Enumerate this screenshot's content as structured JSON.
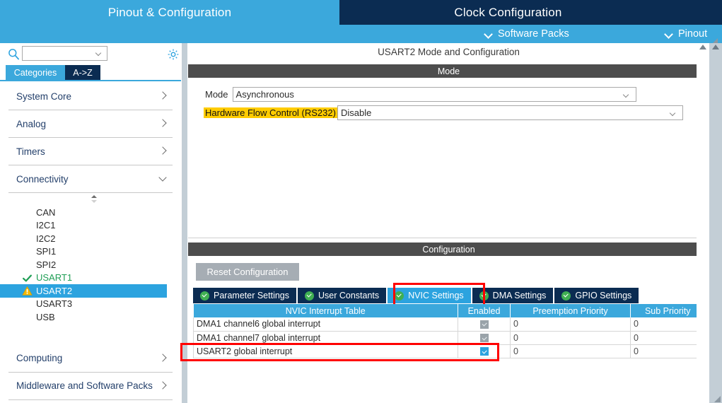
{
  "header": {
    "tabs": [
      {
        "label": "Pinout & Configuration",
        "active": true
      },
      {
        "label": "Clock Configuration",
        "active": false
      },
      {
        "label": "",
        "active": false
      }
    ],
    "menus": [
      {
        "label": "Software Packs",
        "icon": "chevron-down-icon"
      },
      {
        "label": "Pinout",
        "icon": "chevron-down-icon"
      }
    ]
  },
  "sidebar": {
    "search": {
      "value": "",
      "placeholder": "",
      "icon": "search-icon"
    },
    "settings_icon": "gear-icon",
    "view_tabs": [
      {
        "label": "Categories",
        "active": true
      },
      {
        "label": "A->Z",
        "active": false
      }
    ],
    "groups": [
      {
        "label": "System Core",
        "expanded": false
      },
      {
        "label": "Analog",
        "expanded": false
      },
      {
        "label": "Timers",
        "expanded": false
      },
      {
        "label": "Connectivity",
        "expanded": true
      }
    ],
    "peripherals": [
      {
        "label": "CAN",
        "status": "none"
      },
      {
        "label": "I2C1",
        "status": "none"
      },
      {
        "label": "I2C2",
        "status": "none"
      },
      {
        "label": "SPI1",
        "status": "none"
      },
      {
        "label": "SPI2",
        "status": "none"
      },
      {
        "label": "USART1",
        "status": "ok"
      },
      {
        "label": "USART2",
        "status": "warning",
        "selected": true
      },
      {
        "label": "USART3",
        "status": "none"
      },
      {
        "label": "USB",
        "status": "none"
      }
    ],
    "trailing_groups": [
      {
        "label": "Computing",
        "expanded": false
      },
      {
        "label": "Middleware and Software Packs",
        "expanded": false
      }
    ]
  },
  "main": {
    "panel_title": "USART2 Mode and Configuration",
    "mode_section": {
      "header": "Mode",
      "fields": [
        {
          "label": "Mode",
          "value": "Asynchronous",
          "highlighted": false
        },
        {
          "label": "Hardware Flow Control (RS232)",
          "value": "Disable",
          "highlighted": true
        }
      ]
    },
    "config_section": {
      "header": "Configuration",
      "reset_button": "Reset Configuration",
      "tabs": [
        {
          "label": "Parameter Settings",
          "active": false
        },
        {
          "label": "User Constants",
          "active": false
        },
        {
          "label": "NVIC Settings",
          "active": true
        },
        {
          "label": "DMA Settings",
          "active": false
        },
        {
          "label": "GPIO Settings",
          "active": false
        }
      ],
      "table": {
        "columns": [
          "NVIC Interrupt Table",
          "Enabled",
          "Preemption Priority",
          "Sub Priority"
        ],
        "rows": [
          {
            "interrupt": "DMA1 channel6 global interrupt",
            "enabled": true,
            "enabled_locked": true,
            "preemption_priority": "0",
            "sub_priority": "0"
          },
          {
            "interrupt": "DMA1 channel7 global interrupt",
            "enabled": true,
            "enabled_locked": true,
            "preemption_priority": "0",
            "sub_priority": "0"
          },
          {
            "interrupt": "USART2 global interrupt",
            "enabled": true,
            "enabled_locked": false,
            "preemption_priority": "0",
            "sub_priority": "0"
          }
        ]
      }
    }
  },
  "colors": {
    "accent_blue": "#3ba8dc",
    "dark_navy": "#0b2c52",
    "section_gray": "#4d4d4d",
    "highlight_yellow": "#ffcc00",
    "annotation_red": "#ff0000",
    "ok_green": "#1f9e55",
    "warn_amber": "#f5b800"
  }
}
